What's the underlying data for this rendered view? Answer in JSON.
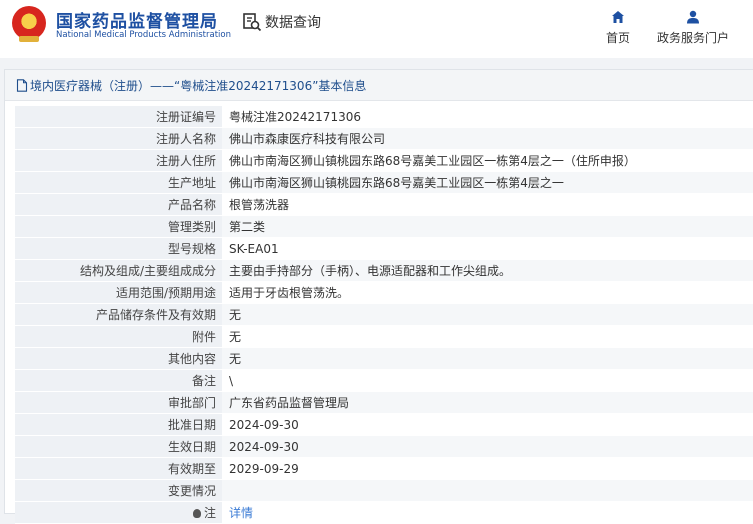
{
  "header": {
    "brand_cn": "国家药品监督管理局",
    "brand_en": "National Medical Products Administration",
    "search_label": "数据查询",
    "nav": [
      {
        "label": "首页",
        "icon": "home-icon"
      },
      {
        "label": "政务服务门户",
        "icon": "user-icon"
      }
    ]
  },
  "panel": {
    "title": "境内医疗器械（注册）——“粤械注准20242171306”基本信息"
  },
  "rows": [
    {
      "label": "注册证编号",
      "value": "粤械注准20242171306"
    },
    {
      "label": "注册人名称",
      "value": "佛山市森康医疗科技有限公司"
    },
    {
      "label": "注册人住所",
      "value": "佛山市南海区狮山镇桃园东路68号嘉美工业园区一栋第4层之一（住所申报）"
    },
    {
      "label": "生产地址",
      "value": "佛山市南海区狮山镇桃园东路68号嘉美工业园区一栋第4层之一"
    },
    {
      "label": "产品名称",
      "value": "根管荡洗器"
    },
    {
      "label": "管理类别",
      "value": "第二类"
    },
    {
      "label": "型号规格",
      "value": "SK-EA01"
    },
    {
      "label": "结构及组成/主要组成成分",
      "value": "主要由手持部分（手柄）、电源适配器和工作尖组成。"
    },
    {
      "label": "适用范围/预期用途",
      "value": "适用于牙齿根管荡洗。"
    },
    {
      "label": "产品储存条件及有效期",
      "value": "无"
    },
    {
      "label": "附件",
      "value": "无"
    },
    {
      "label": "其他内容",
      "value": "无"
    },
    {
      "label": "备注",
      "value": "\\"
    },
    {
      "label": "审批部门",
      "value": "广东省药品监督管理局"
    },
    {
      "label": "批准日期",
      "value": "2024-09-30"
    },
    {
      "label": "生效日期",
      "value": "2024-09-30"
    },
    {
      "label": "有效期至",
      "value": "2029-09-29"
    },
    {
      "label": "变更情况",
      "value": ""
    }
  ],
  "note": {
    "label": "注",
    "link": "详情"
  }
}
